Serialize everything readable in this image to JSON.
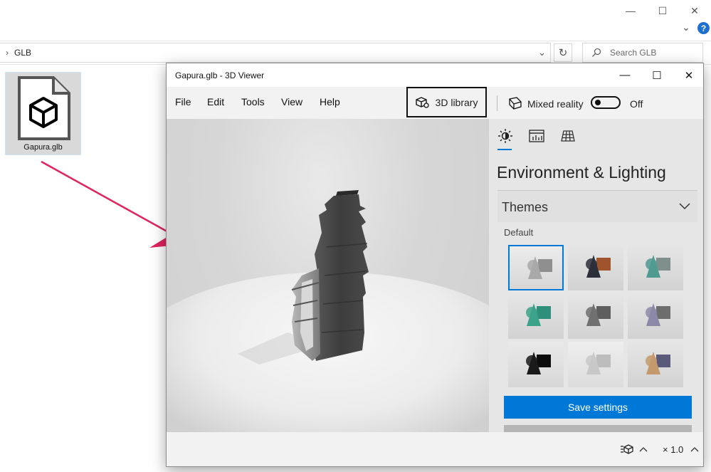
{
  "explorer": {
    "window_controls": {
      "minimize": "—",
      "maximize": "☐",
      "close": "✕"
    },
    "expand_chevron": "⌄",
    "help": "?",
    "address": {
      "chevron": "›",
      "path": "GLB",
      "dropdown": "⌄",
      "refresh": "↻"
    },
    "search": {
      "placeholder": "Search GLB"
    },
    "file": {
      "name": "Gapura.glb"
    }
  },
  "viewer": {
    "title": "Gapura.glb - 3D Viewer",
    "title_controls": {
      "minimize": "—",
      "maximize": "☐",
      "close": "✕"
    },
    "menu": [
      "File",
      "Edit",
      "Tools",
      "View",
      "Help"
    ],
    "library_button": "3D library",
    "mixed_reality": {
      "label": "Mixed reality",
      "state": "Off"
    },
    "panel": {
      "tabs": [
        "environment-tab",
        "stats-tab",
        "grid-tab"
      ],
      "title": "Environment & Lighting",
      "themes_label": "Themes",
      "default_label": "Default",
      "save_button": "Save settings"
    },
    "status": {
      "zoom": "× 1.0"
    }
  },
  "colors": {
    "accent": "#0078d7",
    "arrow": "#e0245e"
  },
  "themes": [
    {
      "shape": "#a9a9a9",
      "box": "#8f8f8f",
      "bg_top": "#ececec",
      "bg_bot": "#d7d7d7"
    },
    {
      "shape": "#2b2f3a",
      "box": "#a0542e",
      "bg_top": "#e6e6e6",
      "bg_bot": "#d2d2d2"
    },
    {
      "shape": "#4f9a91",
      "box": "#7f8f8c",
      "bg_top": "#e6e6e6",
      "bg_bot": "#d2d2d2"
    },
    {
      "shape": "#3aa38a",
      "box": "#2f8f7a",
      "bg_top": "#e6e6e6",
      "bg_bot": "#d2d2d2"
    },
    {
      "shape": "#707070",
      "box": "#5e5e5e",
      "bg_top": "#e6e6e6",
      "bg_bot": "#d2d2d2"
    },
    {
      "shape": "#8c88a8",
      "box": "#6d6d6d",
      "bg_top": "#e6e6e6",
      "bg_bot": "#d2d2d2"
    },
    {
      "shape": "#1a1a1a",
      "box": "#0d0d0d",
      "bg_top": "#e9e9e9",
      "bg_bot": "#d7d7d7"
    },
    {
      "shape": "#c8c8c8",
      "box": "#bdbdbd",
      "bg_top": "#eeeeee",
      "bg_bot": "#dcdcdc"
    },
    {
      "shape": "#c49a6c",
      "box": "#5a5a7a",
      "bg_top": "#e6e6e6",
      "bg_bot": "#d2d2d2"
    }
  ]
}
